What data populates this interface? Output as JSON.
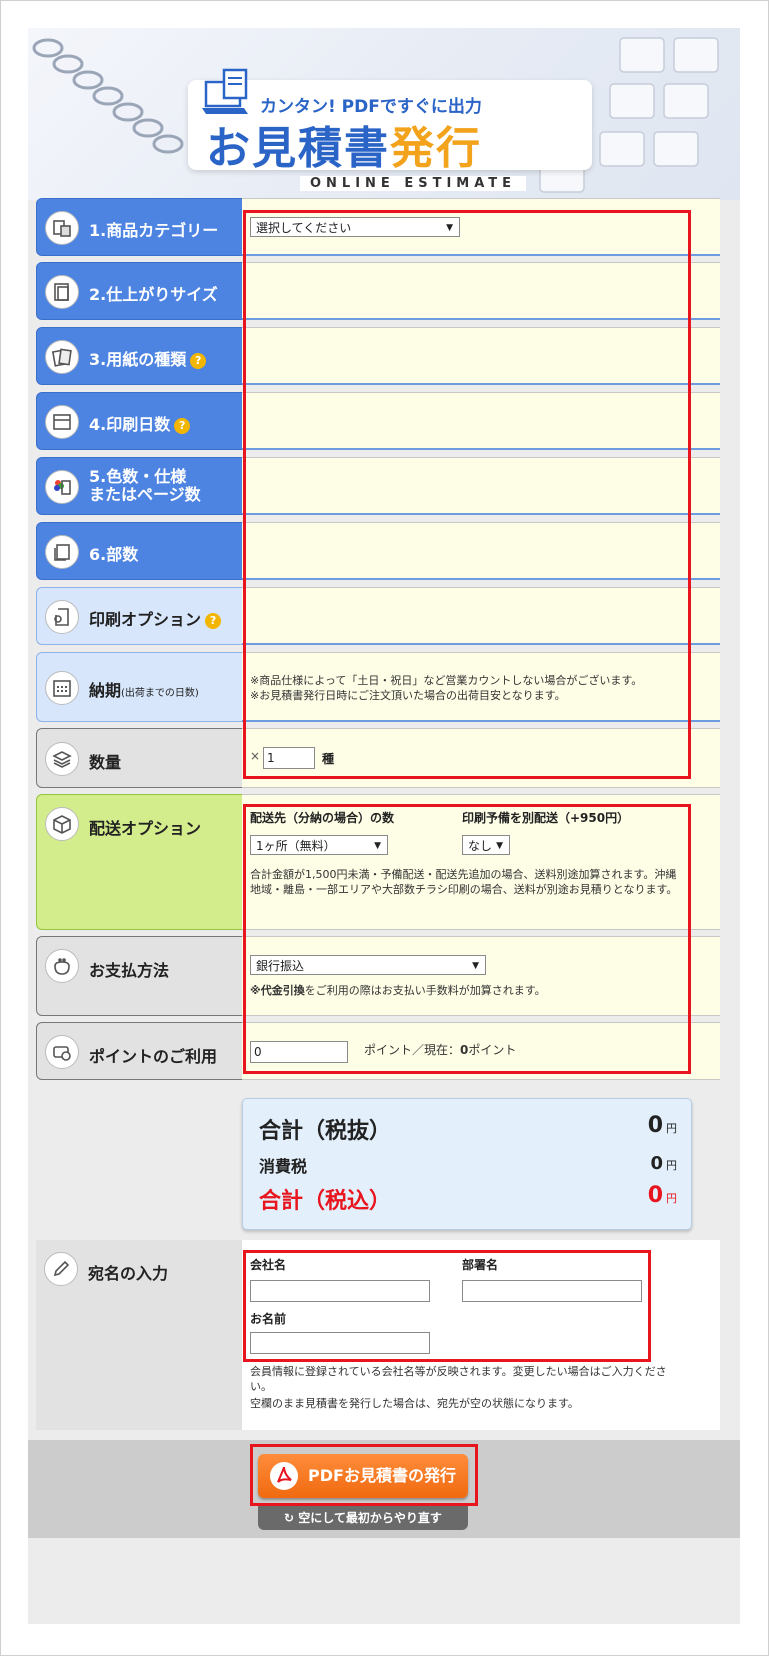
{
  "header": {
    "tagline": "カンタン! PDFですぐに出力",
    "title_blue": "お見積書",
    "title_orange": "発行",
    "subtitle": "ONLINE ESTIMATE"
  },
  "rows": {
    "category": {
      "label": "1.商品カテゴリー",
      "select": "選択してください"
    },
    "size": {
      "label": "2.仕上がりサイズ"
    },
    "paper": {
      "label": "3.用紙の種類"
    },
    "days": {
      "label": "4.印刷日数"
    },
    "colors": {
      "label_l1": "5.色数・仕様",
      "label_l2": "またはページ数"
    },
    "copies": {
      "label": "6.部数"
    },
    "print_option": {
      "label": "印刷オプション"
    },
    "delivery": {
      "label": "納期",
      "label_small": "(出荷までの日数)",
      "note1": "※商品仕様によって「土日・祝日」など営業カウントしない場合がございます。",
      "note2": "※お見積書発行日時にご注文頂いた場合の出荷目安となります。"
    },
    "quantity": {
      "label": "数量",
      "prefix": "×",
      "value": "1",
      "unit": "種"
    },
    "shipping": {
      "label": "配送オプション",
      "dest_label": "配送先（分納の場合）の数",
      "dest_value": "1ヶ所（無料）",
      "spare_label": "印刷予備を別配送（+950円）",
      "spare_value": "なし",
      "note": "合計金額が1,500円未満・予備配送・配送先追加の場合、送料別途加算されます。沖縄地域・離島・一部エリアや大部数チラシ印刷の場合、送料が別途お見積りとなります。"
    },
    "payment": {
      "label": "お支払方法",
      "value": "銀行振込",
      "note_bold": "※代金引換",
      "note_rest": "をご利用の際はお支払い手数料が加算されます。"
    },
    "points": {
      "label": "ポイントのご利用",
      "value": "0",
      "text": "ポイント／現在：",
      "current": "0",
      "unit": "ポイント"
    }
  },
  "totals": {
    "subtotal_label": "合計（税抜）",
    "subtotal_value": "0",
    "tax_label": "消費税",
    "tax_value": "0",
    "total_label": "合計（税込）",
    "total_value": "0",
    "yen": "円"
  },
  "address": {
    "label": "宛名の入力",
    "company_label": "会社名",
    "dept_label": "部署名",
    "name_label": "お名前",
    "note1": "会員情報に登録されている会社名等が反映されます。変更したい場合はご入力ください。",
    "note2": "空欄のまま見積書を発行した場合は、宛先が空の状態になります。"
  },
  "buttons": {
    "pdf": "PDFお見積書の発行",
    "reset": "空にして最初からやり直す"
  },
  "colors": {
    "accent_blue": "#4d84e2",
    "highlight_red": "#e8141e",
    "total_red": "#e8141e",
    "button_orange": "#f06a10"
  }
}
